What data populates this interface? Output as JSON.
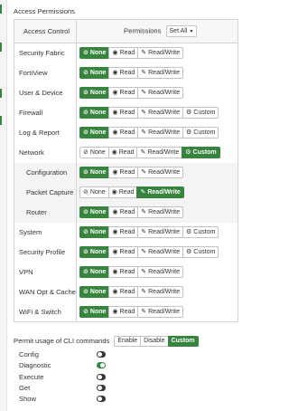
{
  "section_title": "Access Permissions",
  "table": {
    "col_access": "Access Control",
    "col_permissions": "Permissions",
    "set_all_label": "Set All"
  },
  "labels": {
    "none": "None",
    "read": "Read",
    "rw": "Read/Write",
    "custom": "Custom"
  },
  "rows": [
    {
      "name": "Security Fabric",
      "selected": "none",
      "custom": false,
      "sub": false
    },
    {
      "name": "FortiView",
      "selected": "none",
      "custom": false,
      "sub": false
    },
    {
      "name": "User & Device",
      "selected": "none",
      "custom": false,
      "sub": false
    },
    {
      "name": "Firewall",
      "selected": "none",
      "custom": true,
      "sub": false
    },
    {
      "name": "Log & Report",
      "selected": "none",
      "custom": true,
      "sub": false
    },
    {
      "name": "Network",
      "selected": "custom",
      "custom": true,
      "sub": false
    },
    {
      "name": "Configuration",
      "selected": "none",
      "custom": false,
      "sub": true
    },
    {
      "name": "Packet Capture",
      "selected": "rw",
      "custom": false,
      "sub": true
    },
    {
      "name": "Router",
      "selected": "none",
      "custom": false,
      "sub": true
    },
    {
      "name": "System",
      "selected": "none",
      "custom": true,
      "sub": false
    },
    {
      "name": "Security Profile",
      "selected": "none",
      "custom": true,
      "sub": false
    },
    {
      "name": "VPN",
      "selected": "none",
      "custom": false,
      "sub": false
    },
    {
      "name": "WAN Opt & Cache",
      "selected": "none",
      "custom": false,
      "sub": false
    },
    {
      "name": "WiFi & Switch",
      "selected": "none",
      "custom": false,
      "sub": false
    }
  ],
  "cli": {
    "label": "Permit usage of CLI commands",
    "options": [
      "Enable",
      "Disable",
      "Custom"
    ],
    "selected": "Custom",
    "commands": [
      {
        "name": "Config",
        "on": false
      },
      {
        "name": "Diagnostic",
        "on": true
      },
      {
        "name": "Execute",
        "on": false
      },
      {
        "name": "Get",
        "on": false
      },
      {
        "name": "Show",
        "on": false
      }
    ]
  },
  "colors": {
    "accent": "#37843f",
    "border": "#d4d4d4",
    "header_bg": "#f7f7f7",
    "sub_row_bg": "#f4f4f4"
  },
  "icons": {
    "none": "ban-icon",
    "read": "eye-icon",
    "rw": "pencil-icon",
    "custom": "gear-icon"
  }
}
